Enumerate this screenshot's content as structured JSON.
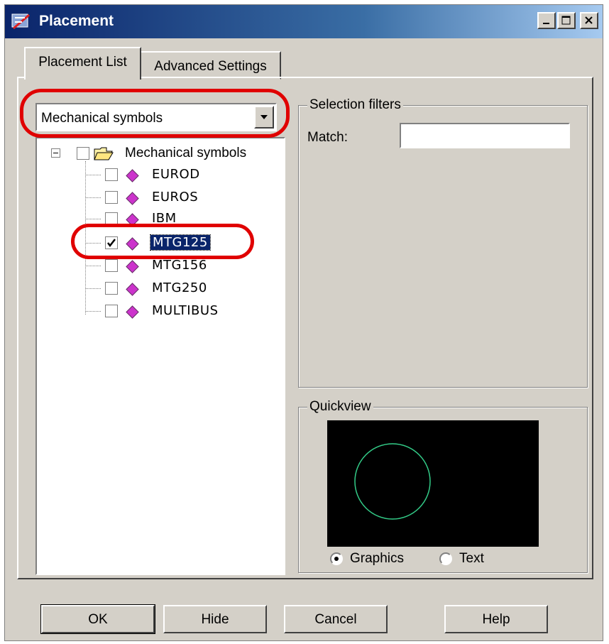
{
  "window": {
    "title": "Placement"
  },
  "caption_buttons": {
    "minimize": "minimize",
    "maximize": "maximize",
    "close": "close"
  },
  "tabs": [
    {
      "label": "Placement List",
      "active": true
    },
    {
      "label": "Advanced Settings",
      "active": false
    }
  ],
  "library_combo": {
    "value": "Mechanical symbols"
  },
  "tree": {
    "root": {
      "label": "Mechanical symbols",
      "expanded": true,
      "checked": false
    },
    "items": [
      {
        "label": "EUROD",
        "checked": false,
        "selected": false
      },
      {
        "label": "EUROS",
        "checked": false,
        "selected": false
      },
      {
        "label": "IBM",
        "checked": false,
        "selected": false
      },
      {
        "label": "MTG125",
        "checked": true,
        "selected": true
      },
      {
        "label": "MTG156",
        "checked": false,
        "selected": false
      },
      {
        "label": "MTG250",
        "checked": false,
        "selected": false
      },
      {
        "label": "MULTIBUS",
        "checked": false,
        "selected": false
      }
    ]
  },
  "selection_filters": {
    "legend": "Selection filters",
    "match_label": "Match:",
    "match_value": ""
  },
  "quickview": {
    "legend": "Quickview",
    "radio_graphics": "Graphics",
    "radio_text": "Text",
    "selected_mode": "Graphics",
    "preview_bg": "#000000",
    "preview_stroke": "#33cc88"
  },
  "buttons": {
    "ok": "OK",
    "hide": "Hide",
    "cancel": "Cancel",
    "help": "Help"
  },
  "colors": {
    "titlebar": "#0a246a",
    "face": "#d4d0c8",
    "selection": "#0a246a",
    "annotation": "#e00000"
  }
}
